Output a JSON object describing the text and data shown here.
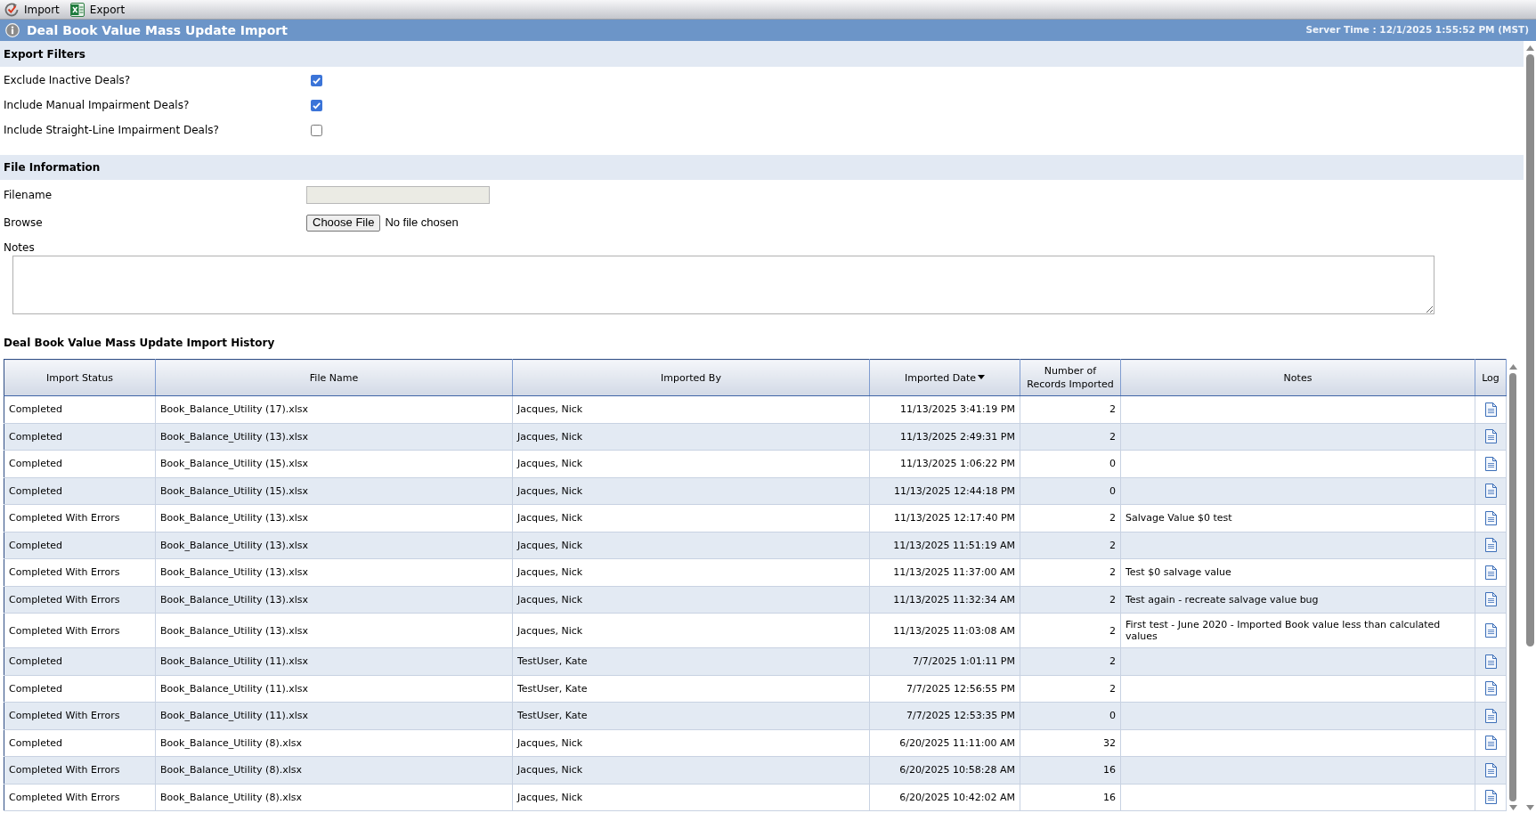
{
  "toolbar": {
    "buttons": [
      {
        "kind": "import",
        "label": "Import"
      },
      {
        "kind": "export",
        "label": "Export"
      }
    ]
  },
  "title_bar": {
    "title": "Deal Book Value Mass Update Import",
    "server_time": "Server Time : 12/1/2025 1:55:52 PM (MST)"
  },
  "export_filters": {
    "heading": "Export Filters",
    "options": [
      {
        "label": "Exclude Inactive Deals?",
        "checked": true
      },
      {
        "label": "Include Manual Impairment Deals?",
        "checked": true
      },
      {
        "label": "Include Straight-Line Impairment Deals?",
        "checked": false
      }
    ]
  },
  "file_information": {
    "heading": "File Information",
    "filename": {
      "label": "Filename",
      "disabled": true
    },
    "browse": {
      "label": "Browse",
      "button": "Choose File",
      "status": "No file chosen"
    },
    "notes": {
      "label": "Notes"
    }
  },
  "import_history": {
    "title": "Deal Book Value Mass Update Import History",
    "columns": [
      {
        "label": "Import Status",
        "sorted": false
      },
      {
        "label": "File Name",
        "sorted": false
      },
      {
        "label": "Imported By",
        "sorted": false
      },
      {
        "label": "Imported Date",
        "sorted": true
      },
      {
        "label": "Number of Records Imported",
        "sorted": false
      },
      {
        "label": "Notes",
        "sorted": false
      },
      {
        "label": "Log",
        "sorted": false
      }
    ],
    "rows": [
      {
        "status": "Completed",
        "file_name": "Book_Balance_Utility (17).xlsx",
        "imported_by": "Jacques, Nick",
        "imported_date": "11/13/2025 3:41:19 PM",
        "records": "2"
      },
      {
        "status": "Completed",
        "file_name": "Book_Balance_Utility (13).xlsx",
        "imported_by": "Jacques, Nick",
        "imported_date": "11/13/2025 2:49:31 PM",
        "records": "2"
      },
      {
        "status": "Completed",
        "file_name": "Book_Balance_Utility (15).xlsx",
        "imported_by": "Jacques, Nick",
        "imported_date": "11/13/2025 1:06:22 PM",
        "records": "0"
      },
      {
        "status": "Completed",
        "file_name": "Book_Balance_Utility (15).xlsx",
        "imported_by": "Jacques, Nick",
        "imported_date": "11/13/2025 12:44:18 PM",
        "records": "0"
      },
      {
        "status": "Completed With Errors",
        "file_name": "Book_Balance_Utility (13).xlsx",
        "imported_by": "Jacques, Nick",
        "imported_date": "11/13/2025 12:17:40 PM",
        "records": "2",
        "notes": "Salvage Value $0 test"
      },
      {
        "status": "Completed",
        "file_name": "Book_Balance_Utility (13).xlsx",
        "imported_by": "Jacques, Nick",
        "imported_date": "11/13/2025 11:51:19 AM",
        "records": "2"
      },
      {
        "status": "Completed With Errors",
        "file_name": "Book_Balance_Utility (13).xlsx",
        "imported_by": "Jacques, Nick",
        "imported_date": "11/13/2025 11:37:00 AM",
        "records": "2",
        "notes": "Test $0 salvage value"
      },
      {
        "status": "Completed With Errors",
        "file_name": "Book_Balance_Utility (13).xlsx",
        "imported_by": "Jacques, Nick",
        "imported_date": "11/13/2025 11:32:34 AM",
        "records": "2",
        "notes": "Test again - recreate salvage value bug"
      },
      {
        "status": "Completed With Errors",
        "file_name": "Book_Balance_Utility (13).xlsx",
        "imported_by": "Jacques, Nick",
        "imported_date": "11/13/2025 11:03:08 AM",
        "records": "2",
        "notes": "First test - June 2020 - Imported Book value less than calculated values"
      },
      {
        "status": "Completed",
        "file_name": "Book_Balance_Utility (11).xlsx",
        "imported_by": "TestUser, Kate",
        "imported_date": "7/7/2025 1:01:11 PM",
        "records": "2"
      },
      {
        "status": "Completed",
        "file_name": "Book_Balance_Utility (11).xlsx",
        "imported_by": "TestUser, Kate",
        "imported_date": "7/7/2025 12:56:55 PM",
        "records": "2"
      },
      {
        "status": "Completed With Errors",
        "file_name": "Book_Balance_Utility (11).xlsx",
        "imported_by": "TestUser, Kate",
        "imported_date": "7/7/2025 12:53:35 PM",
        "records": "0"
      },
      {
        "status": "Completed",
        "file_name": "Book_Balance_Utility (8).xlsx",
        "imported_by": "Jacques, Nick",
        "imported_date": "6/20/2025 11:11:00 AM",
        "records": "32"
      },
      {
        "status": "Completed With Errors",
        "file_name": "Book_Balance_Utility (8).xlsx",
        "imported_by": "Jacques, Nick",
        "imported_date": "6/20/2025 10:58:28 AM",
        "records": "16"
      },
      {
        "status": "Completed With Errors",
        "file_name": "Book_Balance_Utility (8).xlsx",
        "imported_by": "Jacques, Nick",
        "imported_date": "6/20/2025 10:42:02 AM",
        "records": "16"
      }
    ]
  }
}
